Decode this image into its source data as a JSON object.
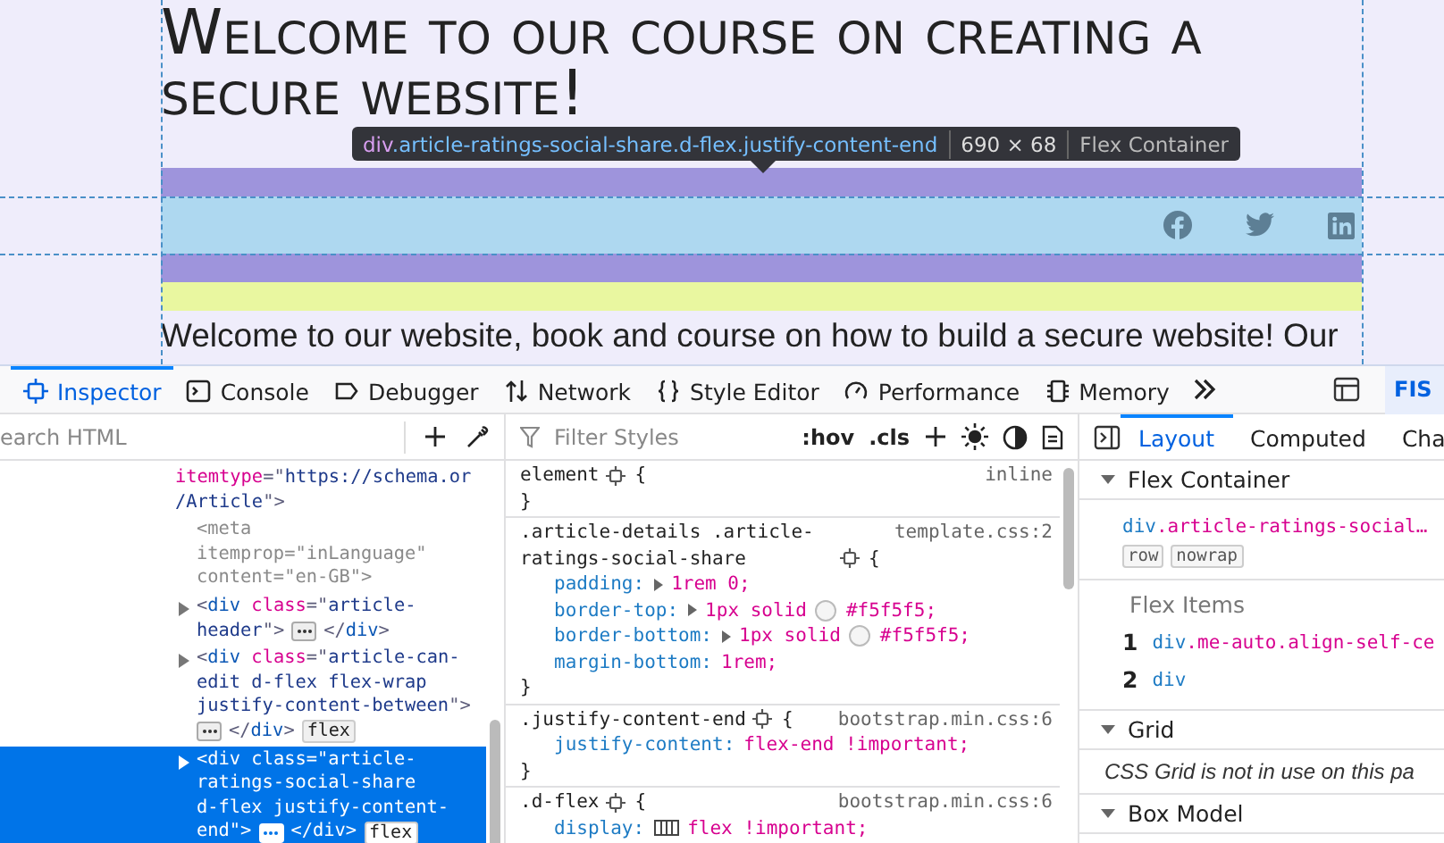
{
  "page": {
    "heading": "Welcome to our course on creating a secure website!",
    "intro": "Welcome to our website, book and course on how to build a secure website! Our",
    "share_icons": [
      {
        "kind": "facebook"
      },
      {
        "kind": "twitter"
      },
      {
        "kind": "linkedin"
      }
    ]
  },
  "highlighter": {
    "tag": "div",
    "classes": ".article-ratings-social-share.d-flex.justify-content-end",
    "size": "690 × 68",
    "type": "Flex Container"
  },
  "toolbar": {
    "tabs": [
      {
        "label": "Inspector",
        "kind": "inspector",
        "selected": true
      },
      {
        "label": "Console",
        "kind": "console",
        "selected": false
      },
      {
        "label": "Debugger",
        "kind": "debugger",
        "selected": false
      },
      {
        "label": "Network",
        "kind": "network",
        "selected": false
      },
      {
        "label": "Style Editor",
        "kind": "style",
        "selected": false
      },
      {
        "label": "Performance",
        "kind": "performance",
        "selected": false
      },
      {
        "label": "Memory",
        "kind": "memory",
        "selected": false
      }
    ],
    "badge": "FIS"
  },
  "markup": {
    "search_placeholder": "earch HTML",
    "nodes": [
      {
        "selected": false,
        "collapsed": false,
        "lines": [
          [
            {
              "kind": "attr",
              "t": "itemtype"
            },
            {
              "kind": "punct",
              "t": "=\""
            },
            {
              "kind": "val",
              "t": "https://schema.or"
            }
          ],
          [
            {
              "kind": "val",
              "t": "/Article"
            },
            {
              "kind": "punct",
              "t": "\">"
            }
          ]
        ],
        "children": [
          {
            "selected": false,
            "collapsed": false,
            "lines": [
              [
                {
                  "kind": "dim",
                  "t": "<meta"
                }
              ],
              [
                {
                  "kind": "dim",
                  "t": "itemprop=\"inLanguage\""
                }
              ],
              [
                {
                  "kind": "dim",
                  "t": "content=\"en-GB\">"
                }
              ]
            ]
          },
          {
            "selected": false,
            "collapsed": true,
            "lines": [
              [
                {
                  "kind": "punct",
                  "t": "<"
                },
                {
                  "kind": "tag",
                  "t": "div"
                },
                {
                  "kind": "attr",
                  "t": " class"
                },
                {
                  "kind": "punct",
                  "t": "=\""
                },
                {
                  "kind": "val",
                  "t": "article-"
                }
              ],
              [
                {
                  "kind": "val",
                  "t": "header"
                },
                {
                  "kind": "punct",
                  "t": "\">"
                },
                {
                  "kind": "more"
                },
                {
                  "kind": "punct",
                  "t": "</"
                },
                {
                  "kind": "tag",
                  "t": "div"
                },
                {
                  "kind": "punct",
                  "t": ">"
                }
              ]
            ]
          },
          {
            "selected": false,
            "collapsed": true,
            "lines": [
              [
                {
                  "kind": "punct",
                  "t": "<"
                },
                {
                  "kind": "tag",
                  "t": "div"
                },
                {
                  "kind": "attr",
                  "t": " class"
                },
                {
                  "kind": "punct",
                  "t": "=\""
                },
                {
                  "kind": "val",
                  "t": "article-can-"
                }
              ],
              [
                {
                  "kind": "val",
                  "t": "edit d-flex flex-wrap"
                }
              ],
              [
                {
                  "kind": "val",
                  "t": "justify-content-between"
                },
                {
                  "kind": "punct",
                  "t": "\">"
                }
              ],
              [
                {
                  "kind": "more"
                },
                {
                  "kind": "punct",
                  "t": "</"
                },
                {
                  "kind": "tag",
                  "t": "div"
                },
                {
                  "kind": "punct",
                  "t": ">"
                },
                {
                  "kind": "badge",
                  "t": "flex"
                }
              ]
            ]
          },
          {
            "selected": true,
            "collapsed": true,
            "lines": [
              [
                {
                  "kind": "punct",
                  "t": "<"
                },
                {
                  "kind": "tag",
                  "t": "div"
                },
                {
                  "kind": "attr",
                  "t": " class"
                },
                {
                  "kind": "punct",
                  "t": "=\""
                },
                {
                  "kind": "val",
                  "t": "article-"
                }
              ],
              [
                {
                  "kind": "val",
                  "t": "ratings-social-share"
                }
              ],
              [
                {
                  "kind": "val",
                  "t": "d-flex justify-content-"
                }
              ],
              [
                {
                  "kind": "val",
                  "t": "end"
                },
                {
                  "kind": "punct",
                  "t": "\">"
                },
                {
                  "kind": "more"
                },
                {
                  "kind": "punct",
                  "t": "</"
                },
                {
                  "kind": "tag",
                  "t": "div"
                },
                {
                  "kind": "punct",
                  "t": ">"
                },
                {
                  "kind": "badge",
                  "t": "flex"
                }
              ]
            ]
          }
        ]
      }
    ]
  },
  "rules": {
    "filter_placeholder": "Filter Styles",
    "pseudo_toggle": ":hov",
    "class_toggle": ".cls",
    "rules": [
      {
        "selector": "element",
        "open_brace": "{",
        "close_brace": "}",
        "source": "inline"
      },
      {
        "selector": ".article-details .article-ratings-social-share",
        "open_brace": "{",
        "close_brace": "}",
        "source": "template.css:2",
        "declarations": [
          {
            "kind": "shorthand",
            "property": "padding:",
            "value": "1rem 0;"
          },
          {
            "kind": "color",
            "property": "border-top:",
            "value": "1px solid",
            "color_value": "#f5f5f5;"
          },
          {
            "kind": "color",
            "property": "border-bottom:",
            "value": "1px solid",
            "color_value": "#f5f5f5;"
          },
          {
            "kind": "plain",
            "property": "margin-bottom:",
            "value": "1rem;"
          }
        ]
      },
      {
        "selector": ".justify-content-end",
        "open_brace": "{",
        "close_brace": "}",
        "source": "bootstrap.min.css:6",
        "declarations": [
          {
            "kind": "plain",
            "property": "justify-content:",
            "value": "flex-end !important;"
          }
        ]
      },
      {
        "selector": ".d-flex",
        "open_brace": "{",
        "source": "bootstrap.min.css:6",
        "declarations": [
          {
            "kind": "flex",
            "property": "display:",
            "value": "flex !important;"
          }
        ]
      }
    ]
  },
  "layout_panel": {
    "tabs": [
      {
        "label": "Layout",
        "selected": true
      },
      {
        "label": "Computed",
        "selected": false
      },
      {
        "label": "Cha",
        "selected": false
      }
    ],
    "sections": [
      {
        "kind": "flex",
        "title": "Flex Container",
        "expanded": true,
        "container": {
          "tag": "div",
          "classes": ".article-ratings-social…"
        },
        "badges": [
          "row",
          "nowrap"
        ],
        "items_title": "Flex Items",
        "items": [
          {
            "index": "1",
            "tag": "div",
            "classes": ".me-auto.align-self-ce"
          },
          {
            "index": "2",
            "tag": "div"
          }
        ]
      },
      {
        "kind": "grid",
        "title": "Grid",
        "expanded": true,
        "message": "CSS Grid is not in use on this pa"
      },
      {
        "kind": "box",
        "title": "Box Model",
        "expanded": true
      }
    ]
  }
}
